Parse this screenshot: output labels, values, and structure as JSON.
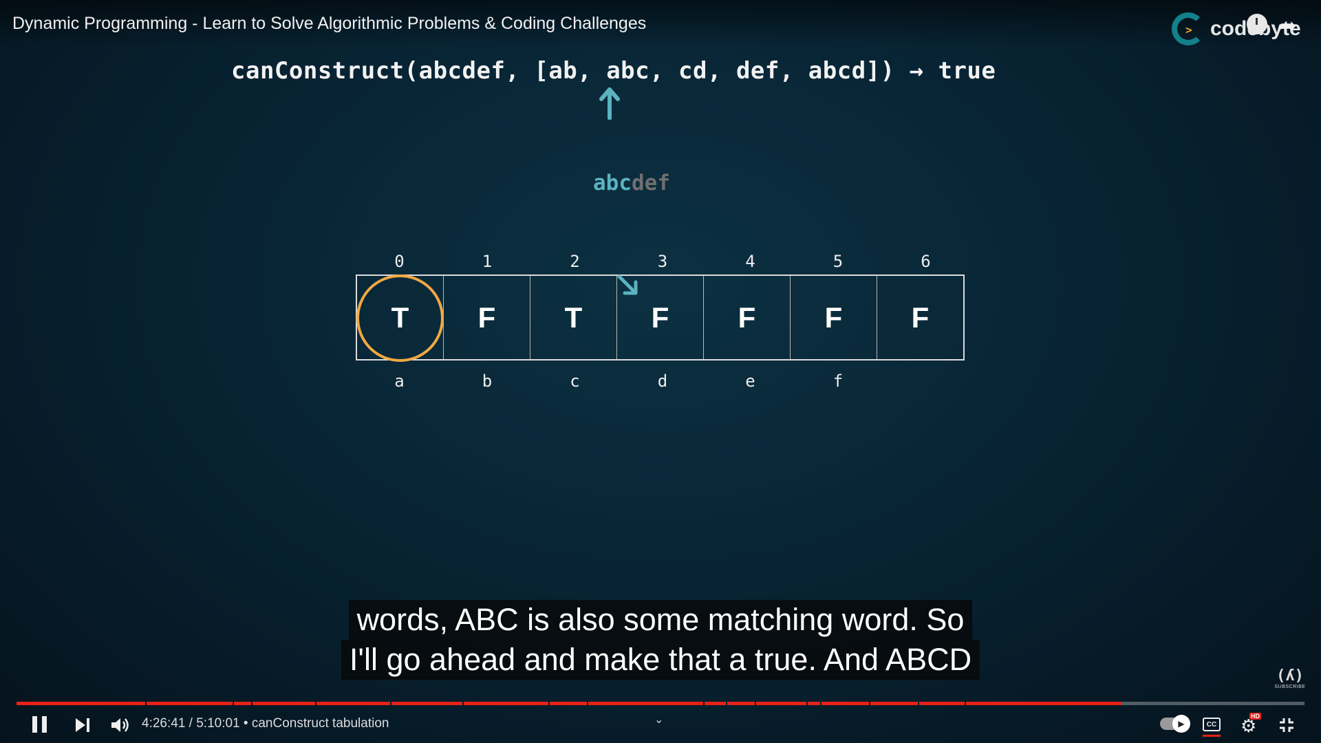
{
  "header": {
    "video_title": "Dynamic Programming - Learn to Solve Algorithmic Problems & Coding Challenges",
    "channel_brand": "codebyte"
  },
  "slide": {
    "formula": "canConstruct(abcdef, [ab, abc, cd, def, abcd]) → true",
    "target_completed": "abc",
    "target_remaining": "def",
    "indices": [
      "0",
      "1",
      "2",
      "3",
      "4",
      "5",
      "6"
    ],
    "cells": [
      "T",
      "F",
      "T",
      "F",
      "F",
      "F",
      "F"
    ],
    "letters": [
      "a",
      "b",
      "c",
      "d",
      "e",
      "f"
    ],
    "highlight_color": "#f0a944",
    "arrow_color": "#5bb3c0"
  },
  "captions": {
    "line1": "words, ABC is also some matching word. So",
    "line2": "I'll go ahead and make that a true. And ABCD"
  },
  "player": {
    "time": "4:26:41 / 5:10:01",
    "chapter": "• canConstruct tabulation",
    "progress_fraction": 0.858,
    "buffered_fraction": 0.862,
    "progress_color": "#e62117",
    "cc_label": "CC",
    "hd_label": "HD",
    "subscribe_label": "SUBSCRIBE"
  }
}
